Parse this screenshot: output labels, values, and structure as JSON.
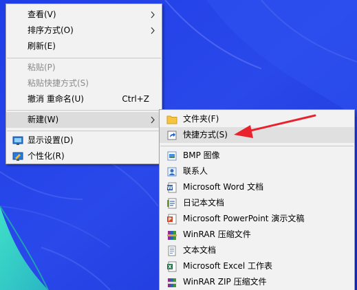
{
  "context_menu": {
    "items": [
      {
        "label": "查看(V)"
      },
      {
        "label": "排序方式(O)"
      },
      {
        "label": "刷新(E)"
      },
      {
        "label": "粘贴(P)"
      },
      {
        "label": "粘贴快捷方式(S)"
      },
      {
        "label": "撤消 重命名(U)",
        "shortcut": "Ctrl+Z"
      },
      {
        "label": "新建(W)"
      },
      {
        "label": "显示设置(D)",
        "icon": "display-settings-icon"
      },
      {
        "label": "个性化(R)",
        "icon": "personalize-icon"
      }
    ]
  },
  "new_submenu": {
    "items": [
      {
        "label": "文件夹(F)",
        "icon": "folder-icon"
      },
      {
        "label": "快捷方式(S)",
        "icon": "shortcut-icon"
      },
      {
        "label": "BMP 图像",
        "icon": "bmp-image-icon"
      },
      {
        "label": "联系人",
        "icon": "contact-icon"
      },
      {
        "label": "Microsoft Word 文档",
        "icon": "word-document-icon"
      },
      {
        "label": "日记本文档",
        "icon": "journal-document-icon"
      },
      {
        "label": "Microsoft PowerPoint 演示文稿",
        "icon": "powerpoint-icon"
      },
      {
        "label": "WinRAR 压缩文件",
        "icon": "winrar-icon"
      },
      {
        "label": "文本文档",
        "icon": "text-document-icon"
      },
      {
        "label": "Microsoft Excel 工作表",
        "icon": "excel-icon"
      },
      {
        "label": "WinRAR ZIP 压缩文件",
        "icon": "winrar-zip-icon"
      }
    ]
  },
  "colors": {
    "desktop_blue": "#1f3ee0",
    "menu_bg": "#f2f2f2",
    "highlight": "#dcdcdc",
    "annotation_arrow": "#e8232d"
  }
}
